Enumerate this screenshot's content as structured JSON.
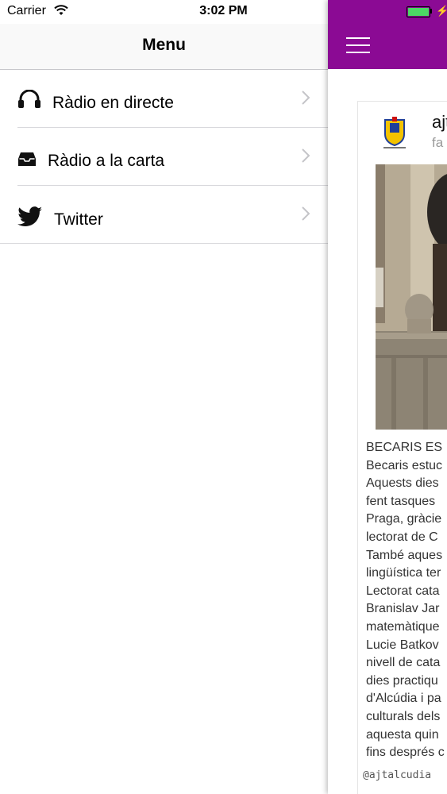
{
  "status_bar": {
    "carrier": "Carrier",
    "time": "3:02 PM"
  },
  "menu": {
    "title": "Menu",
    "items": [
      {
        "label": "Ràdio en directe",
        "icon": "headphones-icon"
      },
      {
        "label": "Ràdio a la carta",
        "icon": "inbox-icon"
      },
      {
        "label": "Twitter",
        "icon": "twitter-bird-icon"
      }
    ]
  },
  "content": {
    "accent_color": "#8b0a94",
    "tweet": {
      "author": "ajt",
      "meta": "fa",
      "text_lines": [
        "BECARIS ES",
        "Becaris estuc",
        "Aquests dies",
        "fent tasques",
        "Praga, gràcie",
        "lectorat de C",
        "També aques",
        "lingüística ter",
        "Lectorat cata",
        "Branislav Jar",
        "matemàtique",
        "Lucie Batkov",
        "nivell de cata",
        "dies practiqu",
        "d'Alcúdia i pa",
        "culturals dels",
        "aquesta quin",
        "fins després c"
      ],
      "handle": "@ajtalcudia"
    }
  }
}
